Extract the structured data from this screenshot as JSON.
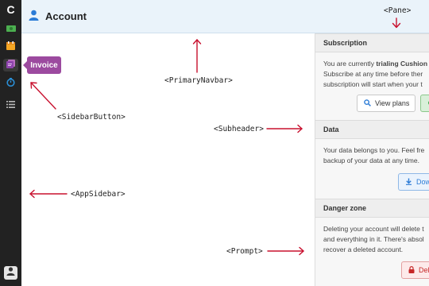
{
  "app": {
    "logo": "C"
  },
  "tooltip": {
    "label": "Invoice"
  },
  "navbar": {
    "title": "Account"
  },
  "pane": {
    "subscription": {
      "heading": "Subscription",
      "line1_prefix": "You are currently ",
      "line1_bold": "trialing Cushion",
      "line2": "Subscribe at any time before ther",
      "line3": "subscription will start when your t",
      "view_plans_label": "View plans"
    },
    "data": {
      "heading": "Data",
      "line1": "Your data belongs to you. Feel fre",
      "line2": "backup of your data at any time.",
      "download_label": "Dow"
    },
    "danger": {
      "heading": "Danger zone",
      "line1": "Deleting your account will delete t",
      "line2": "and everything in it. There's absol",
      "line3": "recover a deleted account.",
      "delete_label": "Dele"
    }
  },
  "annotations": {
    "pane": "<Pane>",
    "primary_navbar": "<PrimaryNavbar>",
    "sidebar_button": "<SidebarButton>",
    "subheader": "<Subheader>",
    "app_sidebar": "<AppSidebar>",
    "prompt": "<Prompt>"
  },
  "colors": {
    "sidebar_bg": "#222222",
    "navbar_bg": "#eaf3fa",
    "tooltip_bg": "#9c4a9f",
    "annotation_arrow": "#c8102e",
    "accent_blue": "#2b7bd6"
  }
}
